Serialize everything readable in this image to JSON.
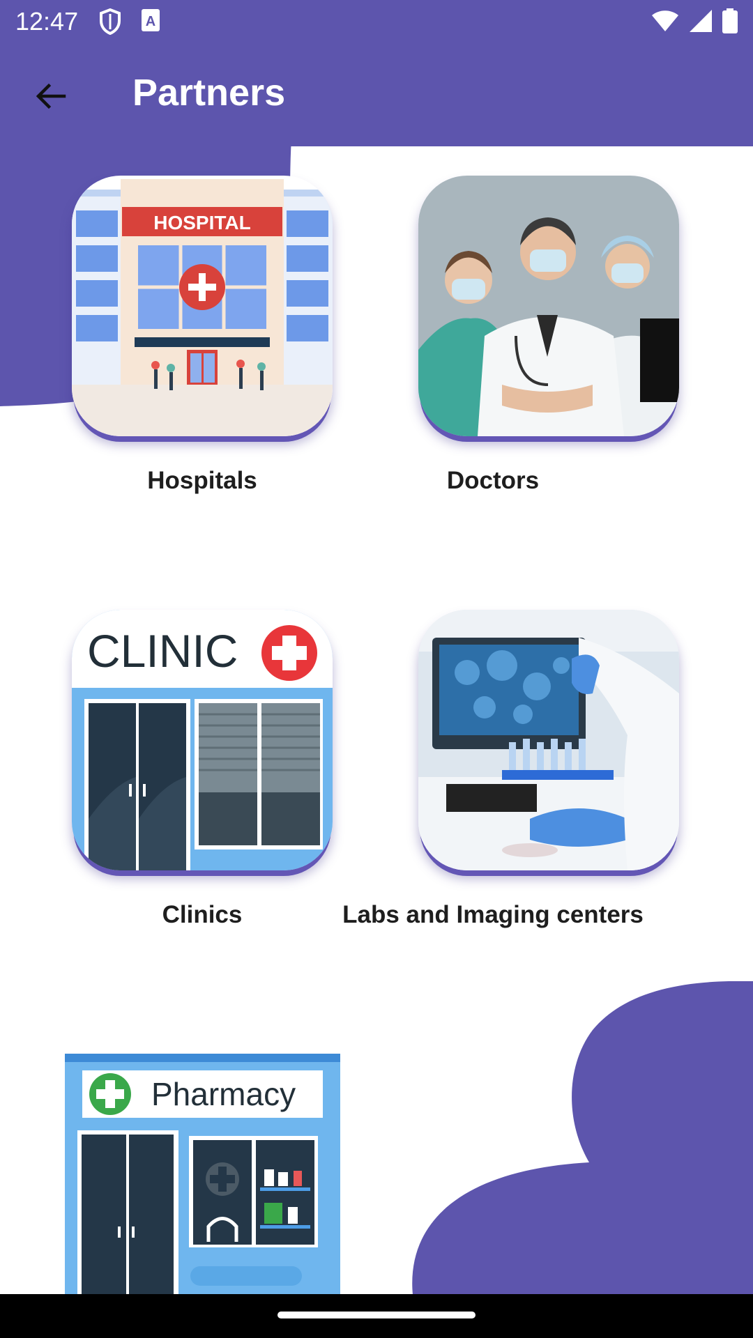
{
  "status_bar": {
    "time": "12:47",
    "icons": [
      "shield-icon",
      "text-a-icon",
      "wifi-icon",
      "signal-icon",
      "battery-icon"
    ]
  },
  "app_bar": {
    "title": "Partners",
    "back_icon": "arrow-back-icon"
  },
  "partners": [
    {
      "label": "Hospitals",
      "image": "hospital-illustration"
    },
    {
      "label": "Doctors",
      "image": "doctors-photo"
    },
    {
      "label": "Clinics",
      "image": "clinic-illustration"
    },
    {
      "label": "Labs and Imaging centers",
      "image": "lab-photo"
    },
    {
      "label": "",
      "image": "pharmacy-illustration"
    }
  ],
  "tile_text": {
    "hospital_sign": "HOSPITAL",
    "clinic_sign": "CLINIC",
    "pharmacy_sign": "Pharmacy"
  },
  "colors": {
    "primary": "#5d55ad",
    "label_text": "#1e1e1e",
    "background": "#ffffff"
  }
}
